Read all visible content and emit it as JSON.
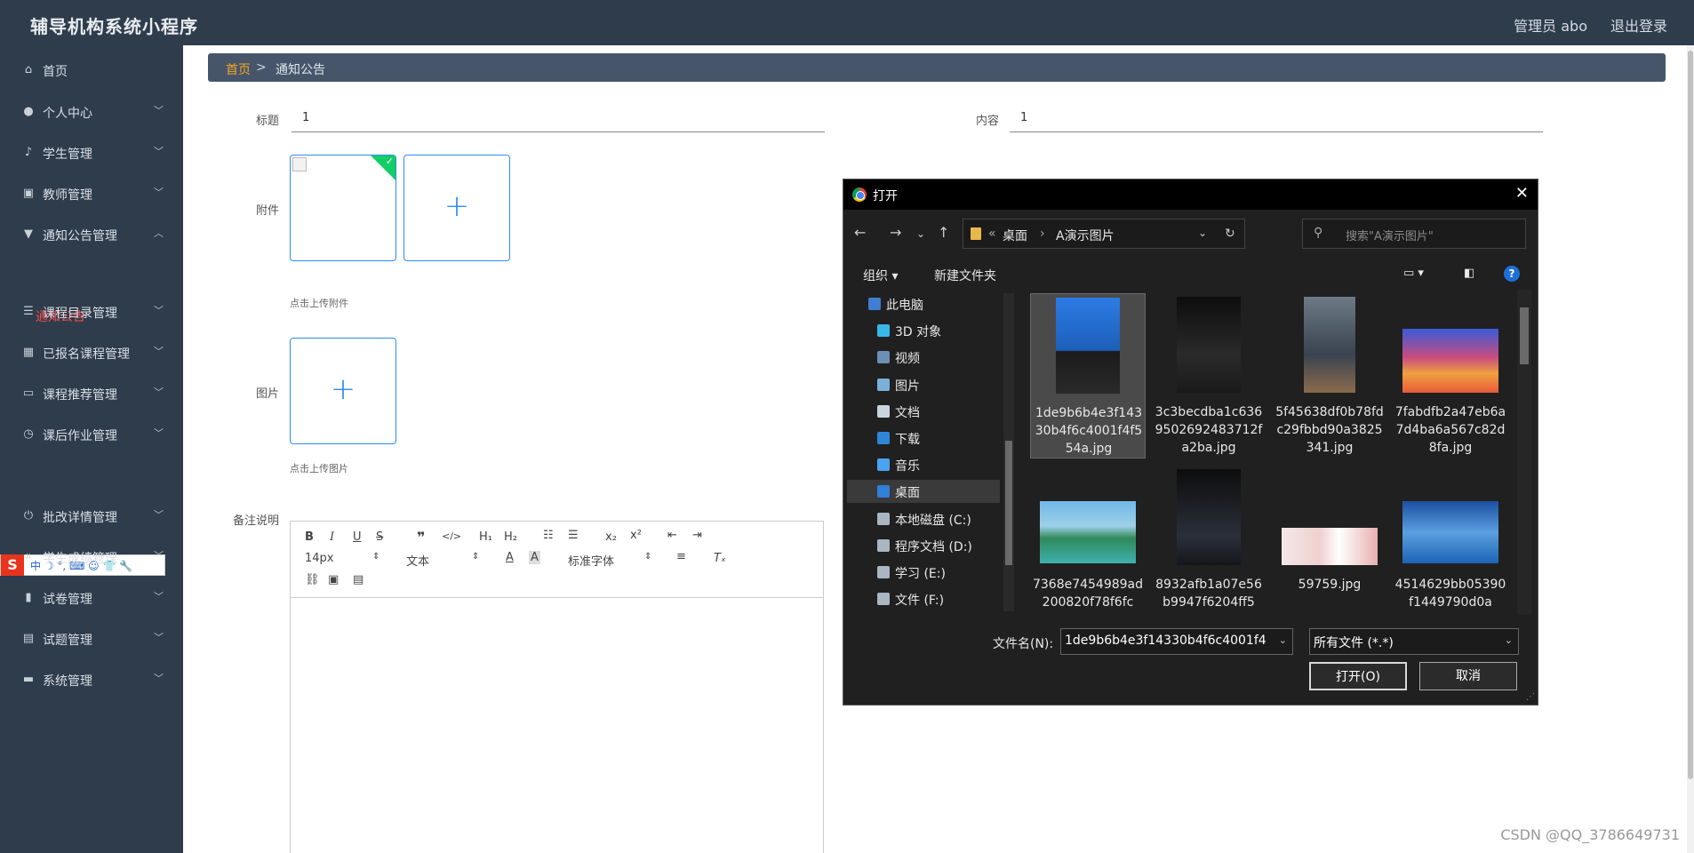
{
  "header": {
    "app_title": "辅导机构系统小程序",
    "user": "管理员 abo",
    "logout": "退出登录"
  },
  "sidebar": {
    "items": [
      {
        "label": "首页",
        "icon": "home-icon",
        "glyph": "⌂"
      },
      {
        "label": "个人中心",
        "icon": "user-icon",
        "glyph": "●"
      },
      {
        "label": "学生管理",
        "icon": "mic-icon",
        "glyph": "♪"
      },
      {
        "label": "教师管理",
        "icon": "id-card-icon",
        "glyph": "▣"
      },
      {
        "label": "通知公告管理",
        "icon": "megaphone-icon",
        "glyph": "▼",
        "expanded": true
      },
      {
        "label": "课程目录管理",
        "icon": "list-icon",
        "glyph": "☰"
      },
      {
        "label": "已报名课程管理",
        "icon": "grid-icon",
        "glyph": "▦"
      },
      {
        "label": "课程推荐管理",
        "icon": "monitor-icon",
        "glyph": "▭"
      },
      {
        "label": "课后作业管理",
        "icon": "clock-icon",
        "glyph": "◷"
      },
      {
        "label": "批改详情管理",
        "icon": "power-icon",
        "glyph": "⏻"
      },
      {
        "label": "学生成绩管理",
        "icon": "crop-icon",
        "glyph": "⌗"
      },
      {
        "label": "试卷管理",
        "icon": "bar-chart-icon",
        "glyph": "▮"
      },
      {
        "label": "试题管理",
        "icon": "doc-icon",
        "glyph": "▤"
      },
      {
        "label": "系统管理",
        "icon": "chat-icon",
        "glyph": "▬"
      }
    ],
    "sub_item": "通知公告",
    "ime": "中 ☽ °, ⌨ ☺ 👕 🔧"
  },
  "breadcrumb": {
    "home": "首页",
    "sep": ">",
    "current": "通知公告"
  },
  "form": {
    "title_label": "标题",
    "title_value": "1",
    "content_label": "内容",
    "content_value": "1",
    "attachment_label": "附件",
    "attachment_hint": "点击上传附件",
    "image_label": "图片",
    "image_hint": "点击上传图片",
    "remark_label": "备注说明"
  },
  "editor": {
    "font_size": "14px",
    "text_style": "文本",
    "font_family": "标准字体"
  },
  "dialog": {
    "title": "打开",
    "path": [
      "«",
      "桌面",
      "›",
      "A演示图片"
    ],
    "search_placeholder": "搜索\"A演示图片\"",
    "organize": "组织 ▾",
    "new_folder": "新建文件夹",
    "nav": [
      {
        "label": "此电脑",
        "color": "#3f7fd0"
      },
      {
        "label": "3D 对象",
        "color": "#38b7e8"
      },
      {
        "label": "视频",
        "color": "#6b8fb5"
      },
      {
        "label": "图片",
        "color": "#7ab1d6"
      },
      {
        "label": "文档",
        "color": "#c9d4de"
      },
      {
        "label": "下载",
        "color": "#2f86d8"
      },
      {
        "label": "音乐",
        "color": "#4aa3f0"
      },
      {
        "label": "桌面",
        "color": "#2e80d8",
        "selected": true
      },
      {
        "label": "本地磁盘 (C:)",
        "color": "#aab6c2"
      },
      {
        "label": "程序文档 (D:)",
        "color": "#aab6c2"
      },
      {
        "label": "学习 (E:)",
        "color": "#aab6c2"
      },
      {
        "label": "文件 (F:)",
        "color": "#aab6c2"
      }
    ],
    "files": [
      {
        "name": "1de9b6b4e3f14330b4f6c4001f4f554a.jpg",
        "selected": true
      },
      {
        "name": "3c3becdba1c6369502692483712fa2ba.jpg"
      },
      {
        "name": "5f45638df0b78fdc29fbbd90a3825341.jpg"
      },
      {
        "name": "7fabdfb2a47eb6a7d4ba6a567c82d8fa.jpg"
      },
      {
        "name": "7368e7454989ad200820f78f6fc"
      },
      {
        "name": "8932afb1a07e56b9947f6204ff5"
      },
      {
        "name": "59759.jpg"
      },
      {
        "name": "4514629bb05390f1449790d0a"
      }
    ],
    "filename_label": "文件名(N):",
    "filename_value": "1de9b6b4e3f14330b4f6c4001f4",
    "filter_value": "所有文件 (*.*)",
    "open": "打开(O)",
    "cancel": "取消"
  },
  "watermark": "CSDN @QQ_3786649731",
  "colors": {
    "sidebar_bg": "#2f3c4c",
    "accent_blue": "#2d8cf0",
    "active_red": "#f05050",
    "breadcrumb_home": "#f5a623",
    "success_green": "#13ce66"
  }
}
